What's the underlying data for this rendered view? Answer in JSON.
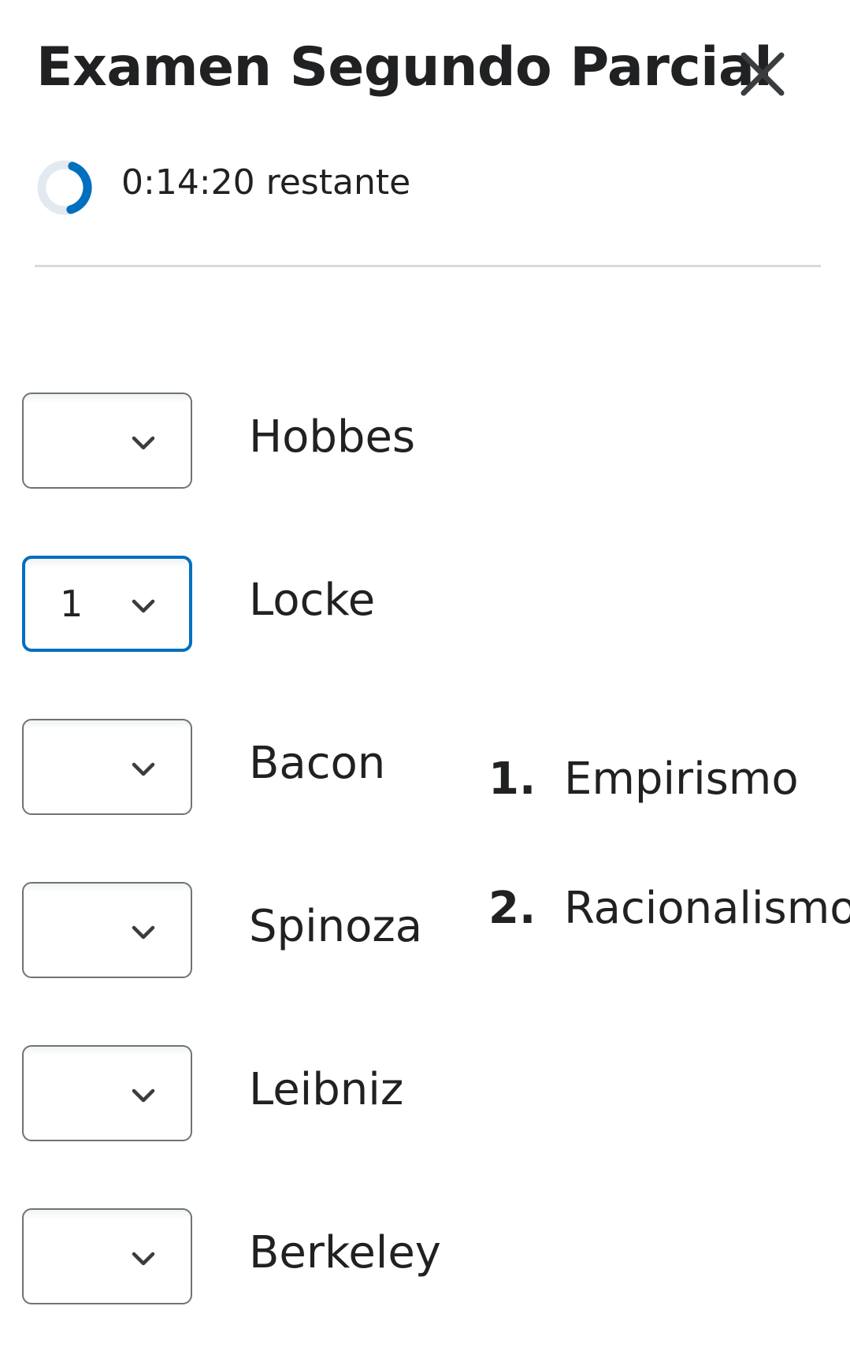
{
  "header": {
    "title": "Examen Segundo Parcial",
    "close_icon": "close-icon"
  },
  "timer": {
    "text": "0:14:20 restante",
    "progress_fraction": 0.4,
    "accent_color": "#006fbf",
    "track_color": "#e3e9f1"
  },
  "matching": {
    "items": [
      {
        "label": "Hobbes",
        "selected": ""
      },
      {
        "label": "Locke",
        "selected": "1"
      },
      {
        "label": "Bacon",
        "selected": ""
      },
      {
        "label": "Spinoza",
        "selected": ""
      },
      {
        "label": "Leibniz",
        "selected": ""
      },
      {
        "label": "Berkeley",
        "selected": ""
      }
    ],
    "choices": [
      {
        "number": "1.",
        "label": "Empirismo"
      },
      {
        "number": "2.",
        "label": "Racionalismo"
      }
    ]
  },
  "colors": {
    "focus_border": "#006fbf",
    "select_border": "#6e7376",
    "divider": "#d6dadc"
  }
}
